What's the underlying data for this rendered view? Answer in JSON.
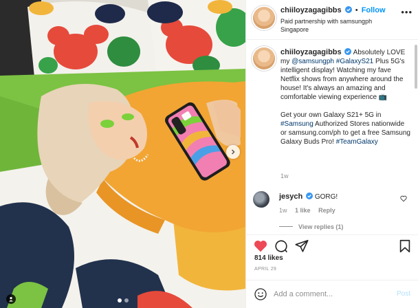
{
  "post": {
    "author": {
      "username": "chiiloyzagagibbs",
      "follow_label": "Follow",
      "separator": "•",
      "paid_partnership": "Paid partnership with samsungph",
      "location": "Singapore"
    },
    "caption": {
      "username": "chiiloyzagagibbs",
      "intro": "Absolutely LOVE my",
      "mention": "@samsungph",
      "hashtag_1": "#GalaxyS21",
      "body": "Plus 5G's intelligent display! Watching my fave Netflix shows from anywhere around the house! It's always an amazing and comfortable viewing experience",
      "emoji": "📺",
      "p2_prefix": "Get your own Galaxy S21+ 5G in",
      "hashtag_2": "#Samsung",
      "p2_body": "Authorized Stores nationwide or samsung.com/ph to get a free Samsung Galaxy Buds Pro!",
      "hashtag_3": "#TeamGalaxy",
      "time": "1w"
    },
    "comments": [
      {
        "username": "jesych",
        "text": "GORG!",
        "time": "1w",
        "likes": "1 like",
        "reply_label": "Reply"
      }
    ],
    "view_replies": "View replies (1)",
    "likes": "814 likes",
    "date": "APRIL 29",
    "add_comment": {
      "placeholder": "Add a comment...",
      "post_label": "Post"
    },
    "carousel": {
      "total": 2,
      "current": 1
    }
  },
  "colors": {
    "accent": "#0095f6",
    "like_red": "#ed4956",
    "hashtag": "#00376b",
    "muted": "#8e8e8e",
    "post_disabled": "#b2dffc"
  },
  "icons": [
    "verified-badge-icon",
    "more-options-icon",
    "heart-icon",
    "comment-icon",
    "share-icon",
    "bookmark-icon",
    "emoji-icon",
    "chevron-right-icon",
    "tag-user-icon"
  ]
}
